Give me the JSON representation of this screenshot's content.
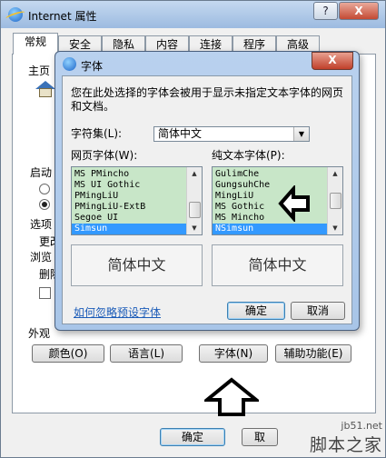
{
  "window": {
    "title": "Internet 属性",
    "help_button": "?",
    "close_button": "X"
  },
  "tabs": [
    "常规",
    "安全",
    "隐私",
    "内容",
    "连接",
    "程序",
    "高级"
  ],
  "general_tab": {
    "homepage_label": "主页",
    "startup_label": "启动",
    "tabs_label": "选项",
    "change_text": "更改",
    "browsing_history_label": "浏览",
    "delete_text": "删除",
    "appearance_label": "外观",
    "appearance_buttons": [
      "颜色(O)",
      "语言(L)",
      "字体(N)",
      "辅助功能(E)"
    ],
    "ok_button": "确定",
    "cancel_button_partial": "取"
  },
  "font_dialog": {
    "title": "字体",
    "close_button": "X",
    "description": "您在此处选择的字体会被用于显示未指定文本字体的网页和文档。",
    "charset_label": "字符集(L):",
    "charset_value": "简体中文",
    "webpage_font_label": "网页字体(W):",
    "plaintext_font_label": "纯文本字体(P):",
    "webpage_fonts": [
      "MS PMincho",
      "MS UI Gothic",
      "PMingLiU",
      "PMingLiU-ExtB",
      "Segoe UI",
      "Simsun"
    ],
    "webpage_font_selected": "Simsun",
    "webpage_scroll_position": 0.8,
    "plaintext_fonts": [
      "GulimChe",
      "GungsuhChe",
      "MingLiU",
      "MS Gothic",
      "MS Mincho",
      "NSimsun"
    ],
    "plaintext_font_selected": "NSimsun",
    "plaintext_scroll_position": 0.45,
    "webpage_preview": "简体中文",
    "plaintext_preview": "简体中文",
    "ignore_settings_link": "如何忽略预设字体",
    "ok_button": "确定",
    "cancel_button": "取消"
  },
  "watermark": {
    "site": "jb51.net",
    "brand": "脚本之家"
  },
  "colors": {
    "list_background": "#c8e6c8",
    "selection": "#3399ff",
    "link": "#1a5bb8"
  }
}
